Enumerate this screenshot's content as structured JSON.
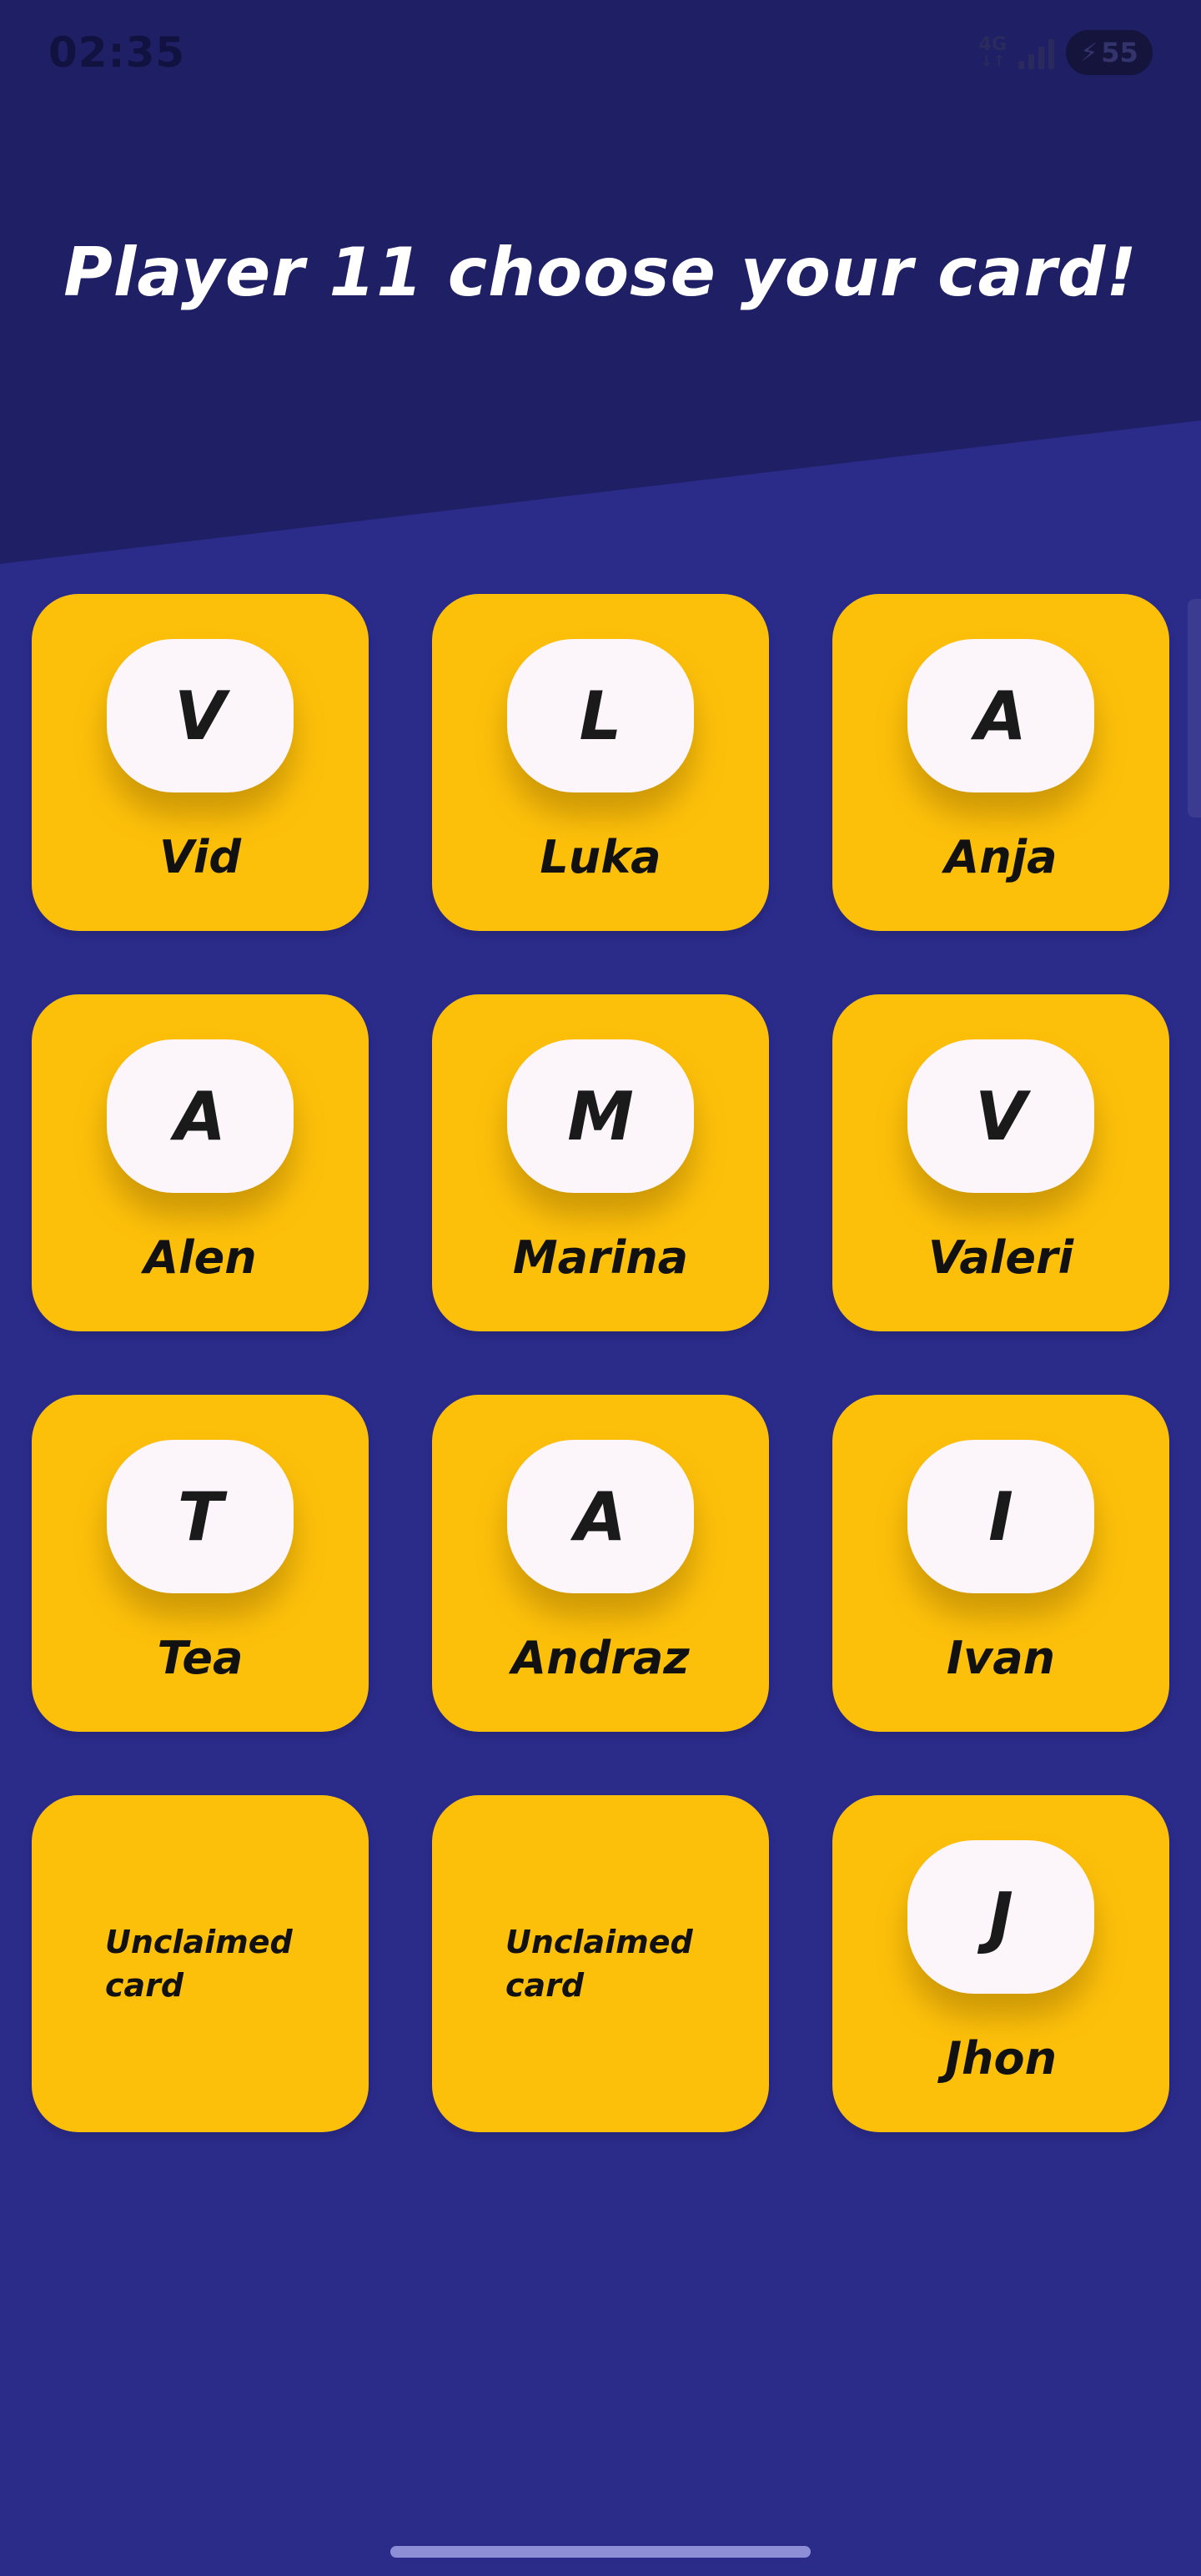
{
  "status_bar": {
    "time": "02:35",
    "network": "4G",
    "network_arrows": "↓↑",
    "battery": "55"
  },
  "title": "Player 11 choose your card!",
  "cards": [
    {
      "initial": "V",
      "name": "Vid"
    },
    {
      "initial": "L",
      "name": "Luka"
    },
    {
      "initial": "A",
      "name": "Anja"
    },
    {
      "initial": "A",
      "name": "Alen"
    },
    {
      "initial": "M",
      "name": "Marina"
    },
    {
      "initial": "V",
      "name": "Valeri"
    },
    {
      "initial": "T",
      "name": "Tea"
    },
    {
      "initial": "A",
      "name": "Andraz"
    },
    {
      "initial": "I",
      "name": "Ivan"
    },
    {
      "unclaimed": true,
      "label": "Unclaimed card"
    },
    {
      "unclaimed": true,
      "label": "Unclaimed card"
    },
    {
      "initial": "J",
      "name": "Jhon"
    }
  ],
  "colors": {
    "background": "#2b2b8a",
    "header_background": "#1f1f66",
    "card": "#fdc00a",
    "avatar": "#fcf6fb",
    "title_text": "#ffffff"
  },
  "icons": {
    "signal": "signal-icon",
    "battery": "battery-charging-icon"
  }
}
